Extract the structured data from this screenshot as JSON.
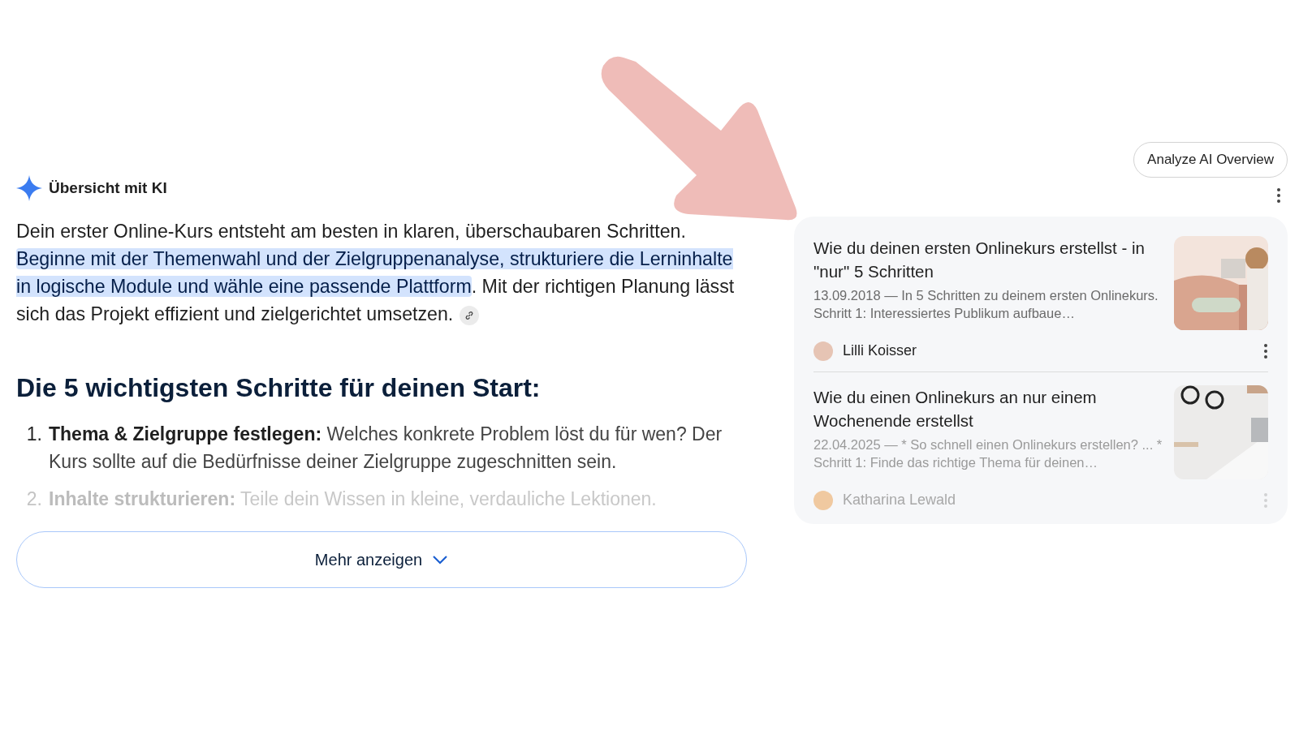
{
  "overview": {
    "title": "Übersicht mit KI"
  },
  "summary": [
    {
      "text": "Dein erster Online-Kurs entsteht am besten in klaren, überschaubaren Schritten. ",
      "highlighted": false
    },
    {
      "text": "Beginne mit der Themenwahl und der Zielgruppenanalyse, strukturiere die Lerninhalte in logische Module und wähle eine passende Plattform",
      "highlighted": true
    },
    {
      "text": ". Mit der richtigen Planung lässt sich das Projekt effizient und zielgerichtet umsetzen.",
      "highlighted": false
    }
  ],
  "heading": "Die 5 wichtigsten Schritte für deinen Start:",
  "steps": [
    {
      "number": "1.",
      "title": "Thema & Zielgruppe festlegen:",
      "text": "Welches konkrete Problem löst du für wen? Der Kurs sollte auf die Bedürfnisse deiner Zielgruppe zugeschnitten sein.",
      "faded": false
    },
    {
      "number": "2.",
      "title": "Inhalte strukturieren:",
      "text": "Teile dein Wissen in kleine, verdauliche Lektionen.",
      "faded": true
    }
  ],
  "show_more_button": {
    "label": "Mehr anzeigen"
  },
  "analyze_button": {
    "label": "Analyze AI Overview"
  },
  "sources": [
    {
      "title": "Wie du deinen ersten Onlinekurs erstellst - in \"nur\" 5 Schritten",
      "snippet": "13.09.2018 — In 5 Schritten zu deinem ersten Onlinekurs. Schritt 1: Interessiertes Publikum aufbaue…",
      "author": "Lilli Koisser",
      "faded": false
    },
    {
      "title": "Wie du einen Onlinekurs an nur einem Wochenende erstellst",
      "snippet": "22.04.2025 — * So schnell einen Onlinekurs erstellen? ... * Schritt 1: Finde das richtige Thema für deinen…",
      "author": "Katharina Lewald",
      "faded": true
    }
  ]
}
